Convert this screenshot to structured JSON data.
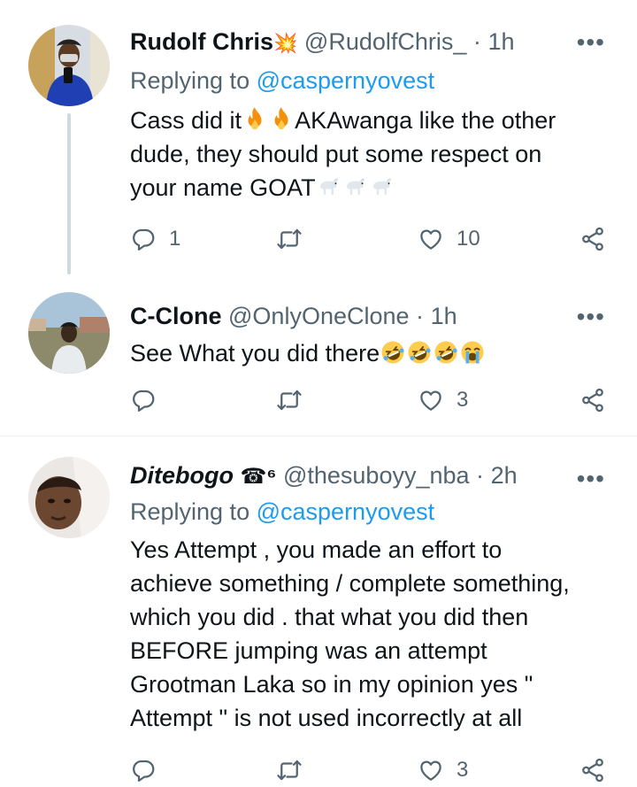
{
  "tweets": [
    {
      "name": "Rudolf Chris",
      "name_badge": "💥",
      "handle": "@RudolfChris_",
      "time": "1h",
      "replying_label": "Replying to",
      "replying_handle": "@caspernyovest",
      "text_line1": "Cass did it",
      "text_line1_after": "AKAwanga like the other",
      "text_line2": "dude, they should put some respect on",
      "text_line3": "your name GOAT",
      "replies": "1",
      "retweets": "",
      "likes": "10"
    },
    {
      "name": "C-Clone",
      "handle": "@OnlyOneClone",
      "time": "1h",
      "text_line1": "See What you did there",
      "replies": "",
      "retweets": "",
      "likes": "3"
    },
    {
      "name": "Ditebogo",
      "name_badge": "☎⁶",
      "handle": "@thesuboyy_nba",
      "time": "2h",
      "replying_label": "Replying to",
      "replying_handle": "@caspernyovest",
      "text_lines": [
        "Yes Attempt , you made an effort to",
        "achieve something / complete something,",
        "which you did . that what you did then",
        "BEFORE jumping was an attempt",
        "Grootman Laka so in my opinion yes \"",
        "Attempt \" is not used incorrectly at all"
      ],
      "replies": "",
      "retweets": "",
      "likes": "3"
    }
  ],
  "separator": "·",
  "more_label": "•••",
  "icons": {
    "reply": "reply-icon",
    "retweet": "retweet-icon",
    "like": "like-icon",
    "share": "share-icon",
    "fire": "fire-emoji",
    "goat": "goat-emoji",
    "laughing": "rofl-emoji",
    "crying": "crying-emoji"
  },
  "colors": {
    "link": "#1d9bf0",
    "muted": "#536471",
    "text": "#0f1419",
    "thread_line": "#cfd9de"
  }
}
